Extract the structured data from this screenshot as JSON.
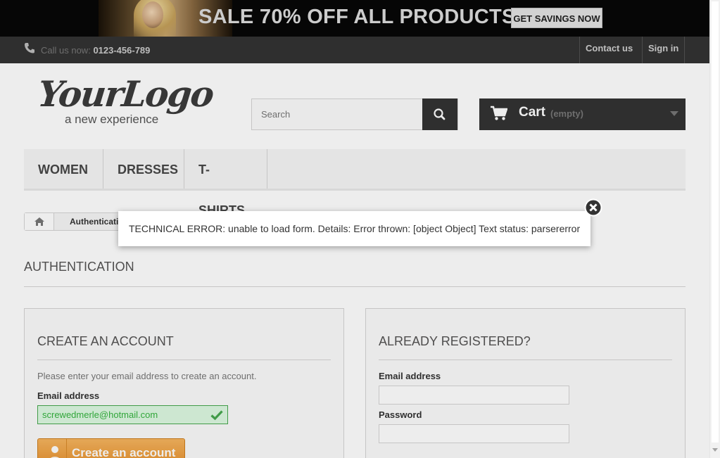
{
  "banner": {
    "text": "SALE 70% OFF ALL PRODUCTS",
    "cta": "GET SAVINGS NOW"
  },
  "nav": {
    "call_label": "Call us now:",
    "phone": "0123-456-789",
    "contact": "Contact us",
    "signin": "Sign in"
  },
  "logo": {
    "title": "YourLogo",
    "tagline": "a new experience"
  },
  "search": {
    "placeholder": "Search",
    "value": ""
  },
  "cart": {
    "label": "Cart",
    "status": "(empty)"
  },
  "menu": {
    "items": [
      "WOMEN",
      "DRESSES",
      "T-SHIRTS"
    ]
  },
  "breadcrumb": {
    "current": "Authentication"
  },
  "page": {
    "title": "AUTHENTICATION"
  },
  "create_account": {
    "title": "CREATE AN ACCOUNT",
    "info": "Please enter your email address to create an account.",
    "email_label": "Email address",
    "email_value": "screwedmerle@hotmail.com",
    "button": "Create an account"
  },
  "login": {
    "title": "ALREADY REGISTERED?",
    "email_label": "Email address",
    "email_value": "",
    "password_label": "Password",
    "password_value": ""
  },
  "error_modal": {
    "message": "TECHNICAL ERROR: unable to load form. Details: Error thrown: [object Object] Text status: parsererror"
  },
  "colors": {
    "banner_bg": "#070707",
    "navbar_bg": "#333333",
    "accent_button": "#f2a13e",
    "valid_field": "#ddf9e1",
    "valid_text": "#35b33f"
  }
}
